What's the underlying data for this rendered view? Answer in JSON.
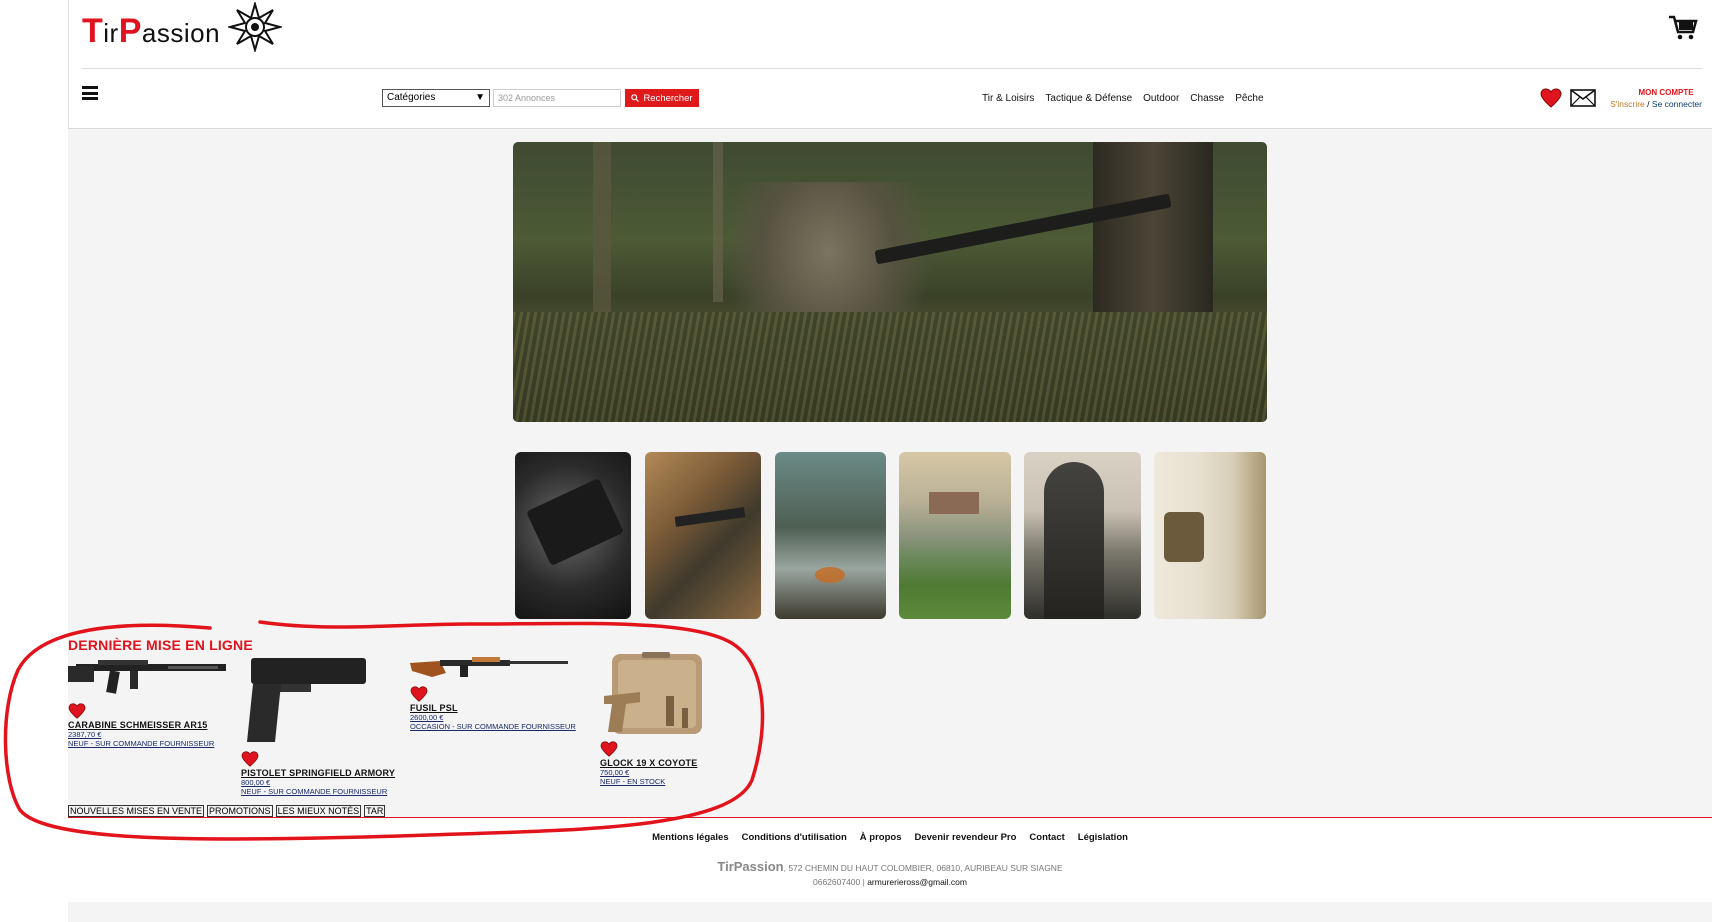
{
  "header": {
    "logo_initial_1": "T",
    "logo_text_1": "ir",
    "logo_initial_2": "P",
    "logo_text_2": "assion"
  },
  "search": {
    "category_selected": "Catégories",
    "placeholder": "302 Annonces",
    "button_label": "Rechercher"
  },
  "nav": {
    "items": [
      "Tir & Loisirs",
      "Tactique & Défense",
      "Outdoor",
      "Chasse",
      "Pêche"
    ]
  },
  "account": {
    "title": "MON COMPTE",
    "signup": "S'inscrire",
    "separator": "/",
    "login": "Se connecter"
  },
  "latest": {
    "title": "DERNIÈRE MISE EN LIGNE",
    "products": [
      {
        "name": "CARABINE SCHMEISSER AR15",
        "price": "2387,70 €",
        "condition": "NEUF - SUR COMMANDE FOURNISSEUR"
      },
      {
        "name": "PISTOLET SPRINGFIELD ARMORY",
        "price": "800,00 €",
        "condition": "NEUF - SUR COMMANDE FOURNISSEUR"
      },
      {
        "name": "FUSIL PSL",
        "price": "2600,00 €",
        "condition": "OCCASION - SUR COMMANDE FOURNISSEUR"
      },
      {
        "name": "GLOCK 19 X COYOTE",
        "price": "750,00 €",
        "condition": "NEUF - EN STOCK"
      }
    ],
    "tabs": [
      "NOUVELLES MISES EN VENTE",
      "PROMOTIONS",
      "LES MIEUX NOTÉS",
      "TAR"
    ]
  },
  "footer": {
    "links": [
      "Mentions légales",
      "Conditions d'utilisation",
      "À propos",
      "Devenir revendeur Pro",
      "Contact",
      "Législation"
    ],
    "brand": "TirPassion",
    "address": ", 572 CHEMIN DU HAUT COLOMBIER, 06810, AURIBEAU SUR SIAGNE",
    "phone": "0662607400",
    "contact_separator": " | ",
    "email": "armurerieross@gmail.com"
  },
  "colors": {
    "brand_red": "#e0141e",
    "search_button": "#e01a1a",
    "link_blue": "#1a2a6b",
    "annotation_red": "#e3131b"
  },
  "icons": [
    "logo-emblem-icon",
    "cart-icon",
    "menu-icon",
    "search-icon",
    "heart-icon",
    "mail-icon"
  ]
}
